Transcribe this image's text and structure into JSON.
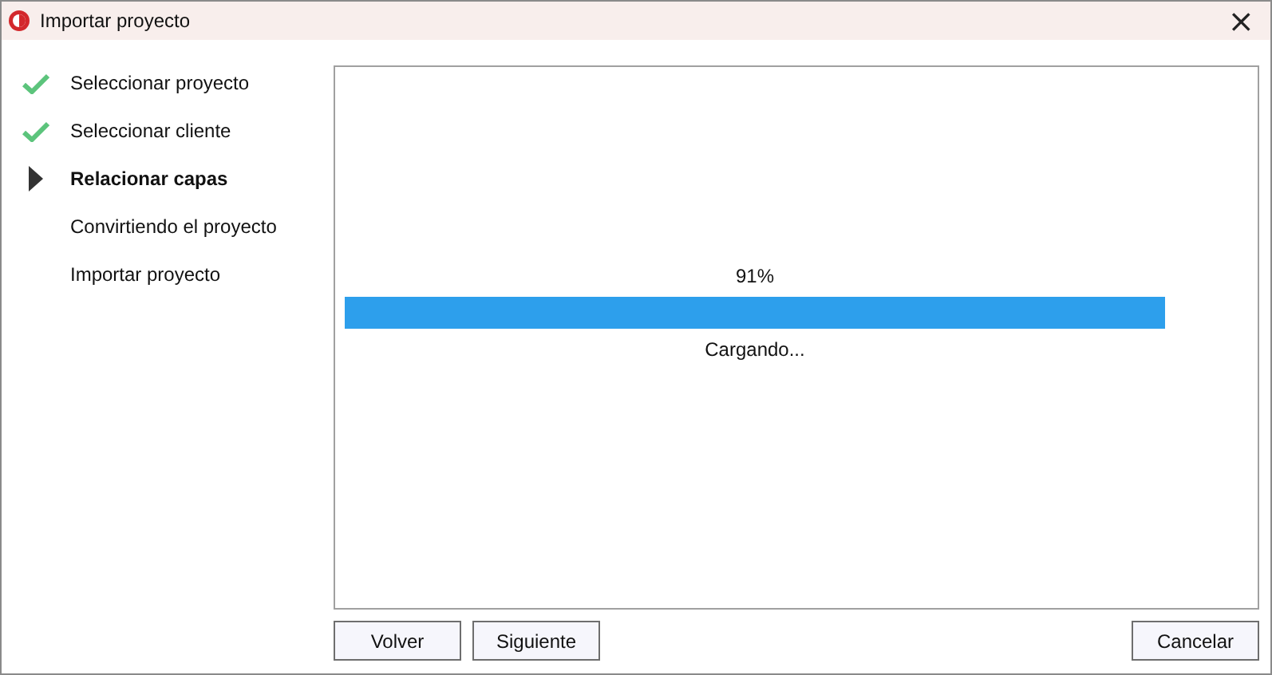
{
  "window": {
    "title": "Importar proyecto",
    "close": "×"
  },
  "steps": [
    {
      "label": "Seleccionar proyecto",
      "kind": "done"
    },
    {
      "label": "Seleccionar cliente",
      "kind": "done"
    },
    {
      "label": "Relacionar capas",
      "kind": "current"
    },
    {
      "label": "Convirtiendo el proyecto",
      "kind": "pending"
    },
    {
      "label": "Importar proyecto",
      "kind": "pending"
    }
  ],
  "progress": {
    "percent": "91%",
    "message": "Cargando..."
  },
  "buttons": [
    {
      "label": "Volver",
      "kind": "nav"
    },
    {
      "label": "Siguiente",
      "kind": "nav"
    },
    {
      "label": "Cancelar",
      "kind": "cancel"
    }
  ]
}
